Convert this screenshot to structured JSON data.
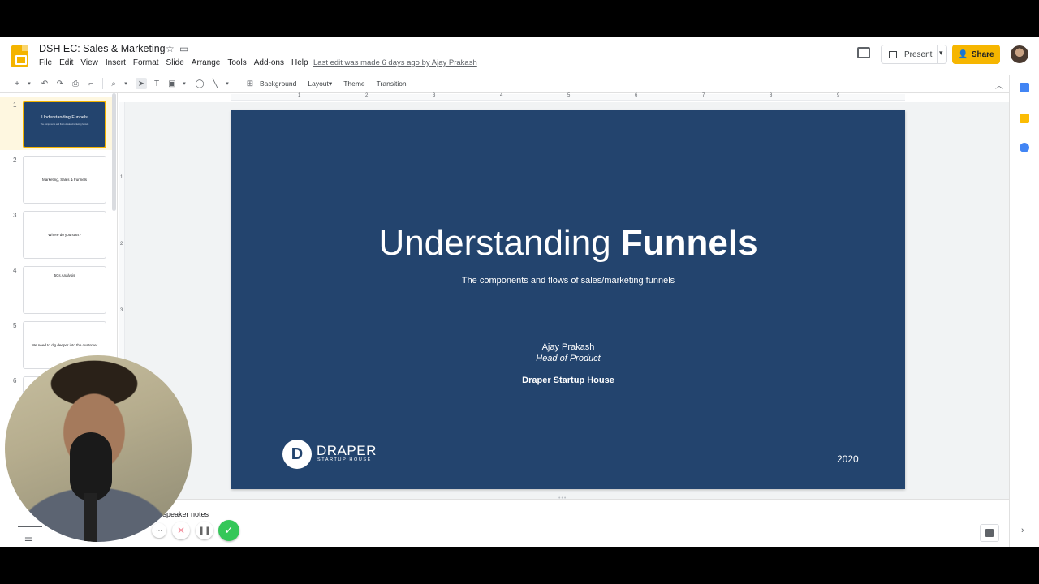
{
  "doc": {
    "title": "DSH EC: Sales & Marketing",
    "last_edit": "Last edit was made 6 days ago by Ajay Prakash"
  },
  "menu": [
    "File",
    "Edit",
    "View",
    "Insert",
    "Format",
    "Slide",
    "Arrange",
    "Tools",
    "Add-ons",
    "Help"
  ],
  "header": {
    "present_label": "Present",
    "share_label": "Share"
  },
  "toolbar": {
    "background": "Background",
    "layout": "Layout",
    "theme": "Theme",
    "transition": "Transition"
  },
  "ruler_h": [
    "1",
    "2",
    "3",
    "4",
    "5",
    "6",
    "7",
    "8",
    "9"
  ],
  "ruler_v": [
    "1",
    "2",
    "3"
  ],
  "filmstrip": [
    {
      "num": "1",
      "text": "Understanding Funnels"
    },
    {
      "num": "2",
      "text": "Marketing, Sales & Funnels"
    },
    {
      "num": "3",
      "text": "Where do you start?"
    },
    {
      "num": "4",
      "text": "5Cs Analysis"
    },
    {
      "num": "5",
      "text": "We need to dig deeper into the customer"
    },
    {
      "num": "6",
      "text": ""
    }
  ],
  "slide": {
    "title_light": "Understanding ",
    "title_bold": "Funnels",
    "subtitle": "The components and flows of sales/marketing funnels",
    "presenter": "Ajay Prakash",
    "role": "Head of Product",
    "organization": "Draper Startup House",
    "logo_letter": "D",
    "logo_text": "DRAPER",
    "logo_sub": "STARTUP HOUSE",
    "year": "2020",
    "bg_color": "#23446e"
  },
  "notes": {
    "placeholder": "d speaker notes"
  },
  "colors": {
    "accent": "#f4b400",
    "share": "#f6b600",
    "slide": "#23446e"
  }
}
